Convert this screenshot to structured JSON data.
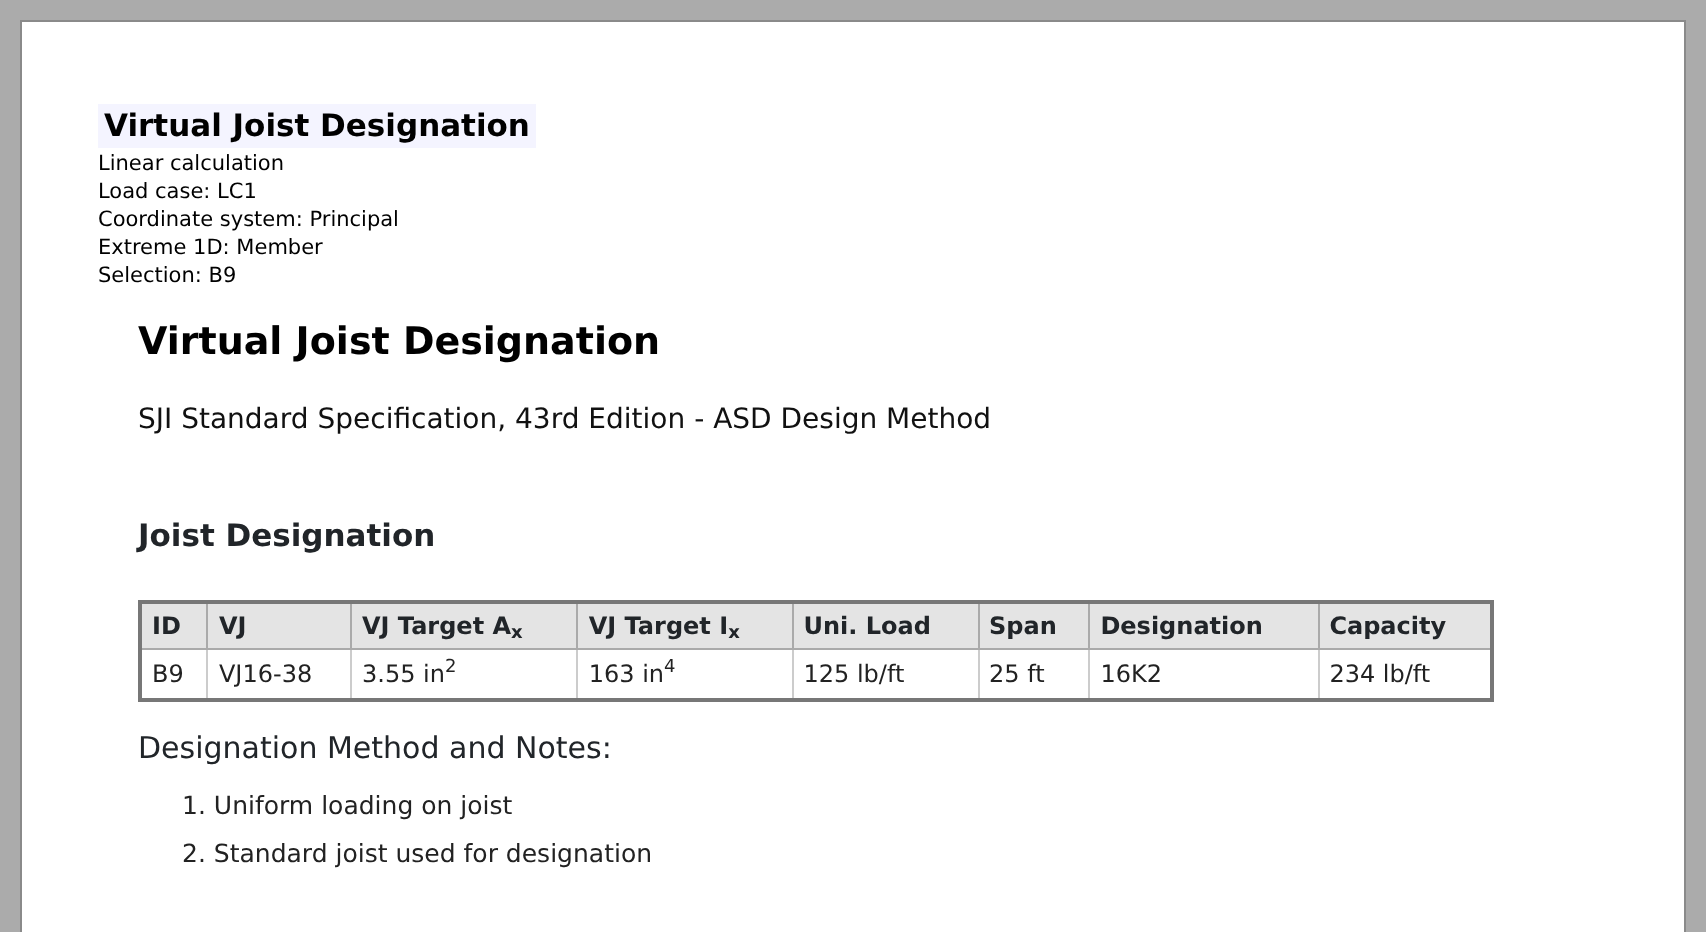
{
  "header": {
    "title": "Virtual Joist Designation",
    "lines": [
      "Linear calculation",
      "Load case: LC1",
      "Coordinate system: Principal",
      "Extreme  1D: Member",
      "Selection: B9"
    ]
  },
  "report": {
    "title": "Virtual Joist Designation",
    "subtitle": "SJI Standard Specification, 43rd Edition - ASD Design Method",
    "section": "Joist Designation",
    "table": {
      "columns": [
        "ID",
        "VJ",
        "VJ Target A$_{x}$",
        "VJ Target I$_{x}$",
        "Uni. Load",
        "Span",
        "Designation",
        "Capacity"
      ],
      "rows": [
        [
          "B9",
          "VJ16-38",
          "3.55 in$^{2}$",
          "163 in$^{4}$",
          "125 lb/ft",
          "25 ft",
          "16K2",
          "234 lb/ft"
        ]
      ]
    },
    "notes_title": "Designation Method and Notes:",
    "notes": [
      {
        "number": "1.",
        "text": "Uniform loading on joist"
      },
      {
        "number": "2.",
        "text": "Standard joist used for designation"
      }
    ]
  }
}
